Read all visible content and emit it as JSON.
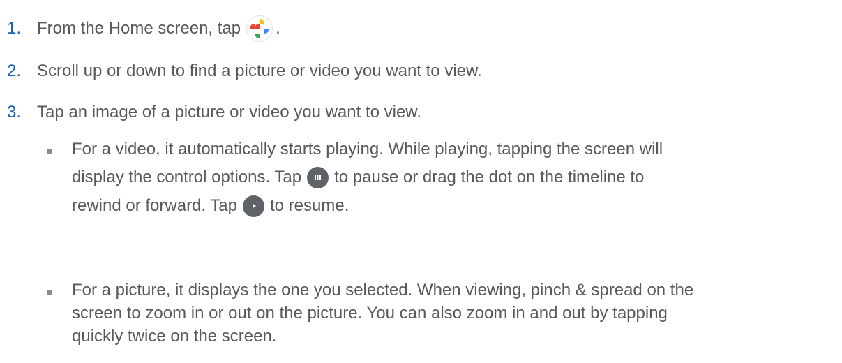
{
  "steps": [
    {
      "number": "1.",
      "text": "From the Home screen, tap",
      "after_icon": ".",
      "icon": "google-photos-icon"
    },
    {
      "number": "2.",
      "text": "Scroll up or down to find a picture or video you want to view."
    },
    {
      "number": "3.",
      "text": "Tap an image of a picture or video you want to view."
    }
  ],
  "bullets": {
    "video": {
      "line1": "For a video, it automatically starts playing. While playing, tapping the screen will",
      "line2_a": "display the control options. Tap",
      "line2_b": "to pause or drag the dot on the timeline to",
      "line3_a": "rewind or forward. Tap",
      "line3_b": "to resume.",
      "pause_icon": "pause-icon",
      "play_icon": "play-icon"
    },
    "picture": {
      "line1": "For a picture, it displays the one you selected. When viewing, pinch & spread on the",
      "line2": "screen to zoom in or out on the picture. You can also zoom in and out by tapping",
      "line3": "quickly twice on the screen."
    }
  },
  "colors": {
    "text": "#595959",
    "step_number": "#1f5fb8",
    "control_button": "#5f6368",
    "bullet": "#8c8c8c",
    "photos_red": "#ea4335",
    "photos_yellow": "#fbbc04",
    "photos_green": "#34a853",
    "photos_blue": "#4285f4"
  }
}
